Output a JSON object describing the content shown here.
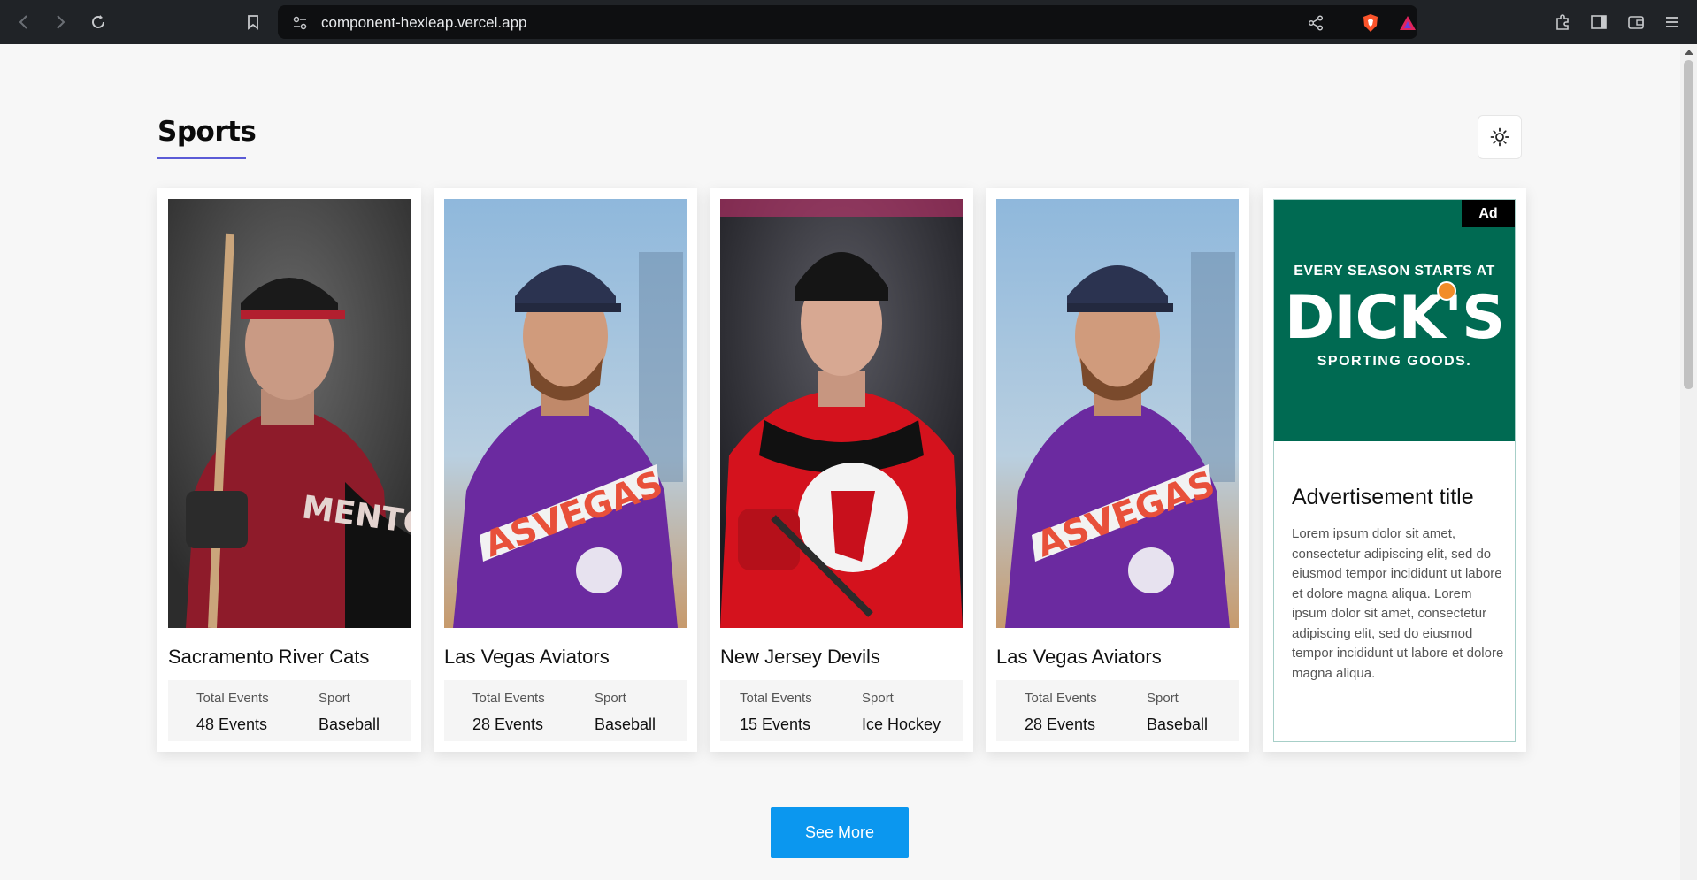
{
  "browser": {
    "url": "component-hexleap.vercel.app",
    "icons": [
      "back-icon",
      "forward-icon",
      "reload-icon",
      "bookmark-icon",
      "site-settings-icon",
      "share-icon",
      "brave-shield-icon",
      "brave-rewards-icon",
      "extensions-icon",
      "sidebar-icon",
      "wallet-icon",
      "menu-icon"
    ]
  },
  "page": {
    "title": "Sports",
    "theme_toggle_icon": "sun-icon",
    "accent_color": "#5b5bd6",
    "button_color": "#0b97ef"
  },
  "cards": [
    {
      "name": "Sacramento River Cats",
      "total_events_label": "Total Events",
      "total_events": "48 Events",
      "sport_label": "Sport",
      "sport": "Baseball",
      "photo": "baseball-player-red-jersey"
    },
    {
      "name": "Las Vegas Aviators",
      "total_events_label": "Total Events",
      "total_events": "28 Events",
      "sport_label": "Sport",
      "sport": "Baseball",
      "photo": "baseball-player-purple-jersey"
    },
    {
      "name": "New Jersey Devils",
      "total_events_label": "Total Events",
      "total_events": "15 Events",
      "sport_label": "Sport",
      "sport": "Ice Hockey",
      "photo": "hockey-player-red-jersey"
    },
    {
      "name": "Las Vegas Aviators",
      "total_events_label": "Total Events",
      "total_events": "28 Events",
      "sport_label": "Sport",
      "sport": "Baseball",
      "photo": "baseball-player-purple-jersey"
    }
  ],
  "ad": {
    "badge": "Ad",
    "image_tagline": "EVERY SEASON STARTS AT",
    "image_brand": "DICK'S",
    "image_sub": "SPORTING GOODS.",
    "title": "Advertisement title",
    "body": "Lorem ipsum dolor sit amet, consectetur adipiscing elit, sed do eiusmod tempor incididunt ut labore et dolore magna aliqua. Lorem ipsum dolor sit amet, consectetur adipiscing elit, sed do eiusmod tempor incididunt ut labore et dolore magna aliqua."
  },
  "see_more_label": "See More"
}
